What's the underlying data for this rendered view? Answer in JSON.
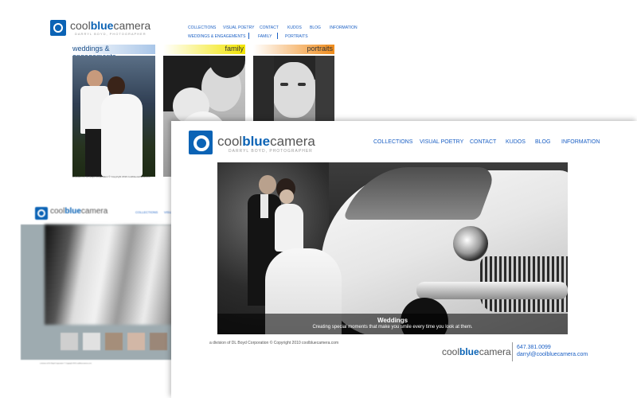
{
  "brand": {
    "logo_prefix": "cool",
    "logo_bold": "blue",
    "logo_suffix": "camera",
    "tagline": "DARRYL BOYD, PHOTOGRAPHER"
  },
  "back_page": {
    "nav_row1": [
      "COLLECTIONS",
      "VISUAL POETRY",
      "CONTACT",
      "KUDOS",
      "BLOG",
      "INFORMATION"
    ],
    "nav_row2": [
      "WEDDINGS & ENGAGEMENTS",
      "FAMILY",
      "PORTRAITS"
    ],
    "categories": [
      {
        "label": "weddings & engagements",
        "color": "#a9c6e8"
      },
      {
        "label": "family",
        "color": "#f2e400"
      },
      {
        "label": "portraits",
        "color": "#f08c1c"
      }
    ],
    "footer": "a division of DL Boyd Corporation © Copyright 2010 coolbluecamera.com"
  },
  "mid_page": {
    "nav_row1": [
      "COLLECTIONS",
      "VISUAL"
    ],
    "footer": "a division of DL Boyd Corporation © Copyright 2010 coolbluecamera.com"
  },
  "front_page": {
    "nav": [
      "COLLECTIONS",
      "VISUAL POETRY",
      "CONTACT",
      "KUDOS",
      "BLOG",
      "INFORMATION"
    ],
    "hero_title": "Weddings",
    "hero_subtitle": "Creating special moments that make you smile every time you look at them.",
    "footer": "a division of DL Boyd Corporation © Copyright 2010 coolbluecamera.com",
    "phone": "647.381.0099",
    "email": "darryl@coolbluecamera.com"
  },
  "colors": {
    "brand_blue": "#0b63b5",
    "link_blue": "#1a5fc4"
  }
}
